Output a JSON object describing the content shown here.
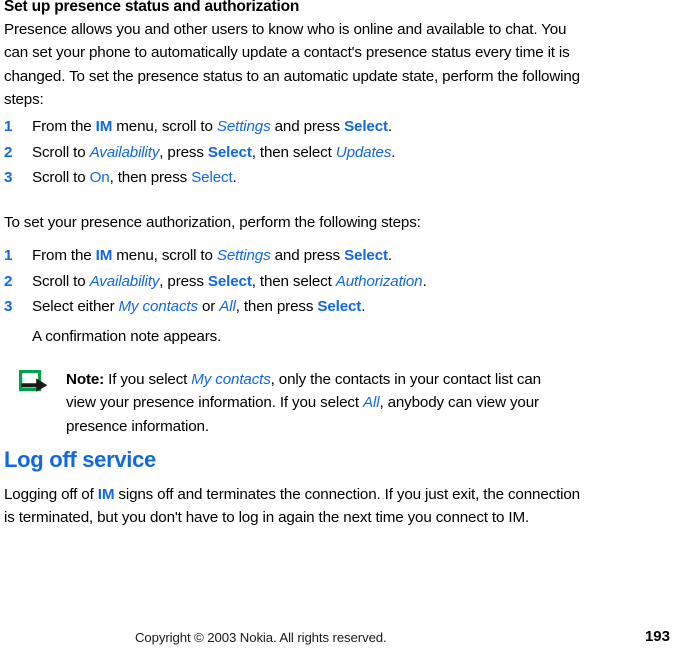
{
  "document": {
    "subheading": "Set up presence status and authorization",
    "intro_paragraph": "Presence allows you and other users to know who is online and available to chat. You can set your phone to automatically update a contact's presence status every time it is changed. To set the presence status to an automatic update state, perform the following steps:",
    "authorization_lead": "To set your presence authorization, perform the following steps:",
    "section_heading": "Log off service",
    "logoff_paragraph_part1": "Logging off of ",
    "logoff_im": "IM",
    "logoff_paragraph_part2": " signs off and terminates the connection.  If you just exit, the connection is terminated, but you don't have to log in again the next time you connect to IM."
  },
  "presence_steps": [
    {
      "number": "1",
      "runs": [
        {
          "text": "From the ",
          "style": "plain"
        },
        {
          "text": "IM",
          "style": "bold-blue"
        },
        {
          "text": " menu, scroll to ",
          "style": "plain"
        },
        {
          "text": "Settings",
          "style": "italic-blue"
        },
        {
          "text": " and press ",
          "style": "plain"
        },
        {
          "text": "Select",
          "style": "bold-blue"
        },
        {
          "text": ".",
          "style": "plain"
        }
      ]
    },
    {
      "number": "2",
      "runs": [
        {
          "text": "Scroll to ",
          "style": "plain"
        },
        {
          "text": "Availability",
          "style": "italic-blue"
        },
        {
          "text": ", press ",
          "style": "plain"
        },
        {
          "text": "Select",
          "style": "bold-blue"
        },
        {
          "text": ", then select ",
          "style": "plain"
        },
        {
          "text": "Updates",
          "style": "italic-blue"
        },
        {
          "text": ".",
          "style": "plain"
        }
      ]
    },
    {
      "number": "3",
      "runs": [
        {
          "text": "Scroll to ",
          "style": "plain"
        },
        {
          "text": "On",
          "style": "normal-blue"
        },
        {
          "text": ", then press ",
          "style": "plain"
        },
        {
          "text": "Select",
          "style": "normal-blue"
        },
        {
          "text": ".",
          "style": "plain"
        }
      ]
    }
  ],
  "authorization_steps": [
    {
      "number": "1",
      "runs": [
        {
          "text": "From the ",
          "style": "plain"
        },
        {
          "text": "IM",
          "style": "bold-blue"
        },
        {
          "text": " menu, scroll to ",
          "style": "plain"
        },
        {
          "text": "Settings",
          "style": "italic-blue"
        },
        {
          "text": " and press ",
          "style": "plain"
        },
        {
          "text": "Select",
          "style": "bold-blue"
        },
        {
          "text": ".",
          "style": "plain"
        }
      ]
    },
    {
      "number": "2",
      "runs": [
        {
          "text": "Scroll to ",
          "style": "plain"
        },
        {
          "text": "Availability",
          "style": "italic-blue"
        },
        {
          "text": ", press ",
          "style": "plain"
        },
        {
          "text": "Select",
          "style": "bold-blue"
        },
        {
          "text": ", then select ",
          "style": "plain"
        },
        {
          "text": "Authorization",
          "style": "italic-blue"
        },
        {
          "text": ".",
          "style": "plain"
        }
      ]
    },
    {
      "number": "3",
      "runs": [
        {
          "text": "Select either ",
          "style": "plain"
        },
        {
          "text": "My contacts",
          "style": "italic-blue"
        },
        {
          "text": " or ",
          "style": "plain"
        },
        {
          "text": "All",
          "style": "italic-blue"
        },
        {
          "text": ", then press ",
          "style": "plain"
        },
        {
          "text": "Select",
          "style": "bold-blue"
        },
        {
          "text": ".",
          "style": "plain"
        }
      ]
    }
  ],
  "authorization_result": "A confirmation note appears.",
  "note": {
    "icon_name": "nokia-note-arrow-icon",
    "icon_square_color": "#00a14b",
    "icon_arrow_color": "#1a1a1a",
    "runs": [
      {
        "text": "Note:",
        "style": "bold-black"
      },
      {
        "text": " If you select ",
        "style": "plain"
      },
      {
        "text": "My contacts",
        "style": "italic-blue"
      },
      {
        "text": ", only the contacts in your contact list can view your presence information. If you select ",
        "style": "plain"
      },
      {
        "text": "All",
        "style": "italic-blue"
      },
      {
        "text": ", anybody can view your presence information.",
        "style": "plain"
      }
    ]
  },
  "footer": {
    "copyright": "Copyright © 2003 Nokia. All rights reserved.",
    "page_number": "193"
  },
  "colors": {
    "accent_blue": "#1168e0",
    "note_green": "#00a14b",
    "text_black": "#000000",
    "background": "#ffffff"
  }
}
